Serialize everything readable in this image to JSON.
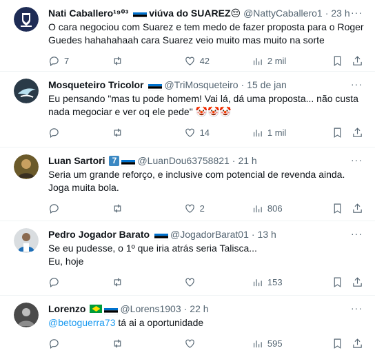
{
  "tweets": [
    {
      "name": "Nati Caballero¹⁹⁰³",
      "name_suffix": "viúva do SUAREZ😔",
      "handle": "@NattyCaballero1",
      "time": "23 h",
      "text": "O cara negociou com Suarez e tem medo de fazer proposta para o Roger Guedes hahahahaah cara Suarez veio muito mas muito na sorte",
      "replies": "7",
      "retweets": "",
      "likes": "42",
      "views": "2 mil"
    },
    {
      "name": "Mosqueteiro Tricolor",
      "handle": "@TriMosqueteiro",
      "time": "15 de jan",
      "text": "Eu pensando \"mas tu pode homem! Vai lá, dá uma proposta... não custa nada megociar e ver oq ele pede\" 🤡🤡🤡",
      "replies": "",
      "retweets": "",
      "likes": "14",
      "views": "1 mil"
    },
    {
      "name": "Luan Sartori",
      "handle": "@LuanDou63758821",
      "time": "21 h",
      "text": "Seria um grande reforço, e inclusive com potencial de revenda ainda. Joga muita bola.",
      "replies": "",
      "retweets": "",
      "likes": "2",
      "views": "806"
    },
    {
      "name": "Pedro Jogador Barato",
      "handle": "@JogadorBarat01",
      "time": "13 h",
      "text_line1": "Se eu pudesse, o 1º que iria atrás seria Talisca...",
      "text_line2": "Eu, hoje",
      "replies": "",
      "retweets": "",
      "likes": "",
      "views": "153"
    },
    {
      "name": "Lorenzo",
      "handle": "@Lorens1903",
      "time": "22 h",
      "mention": "@betoguerra73",
      "text_rest": " tá ai a oportunidade",
      "replies": "",
      "retweets": "",
      "likes": "",
      "views": "595"
    }
  ],
  "colors": {
    "accent": "#1d9bf0",
    "muted": "#536471",
    "text": "#0f1419"
  }
}
